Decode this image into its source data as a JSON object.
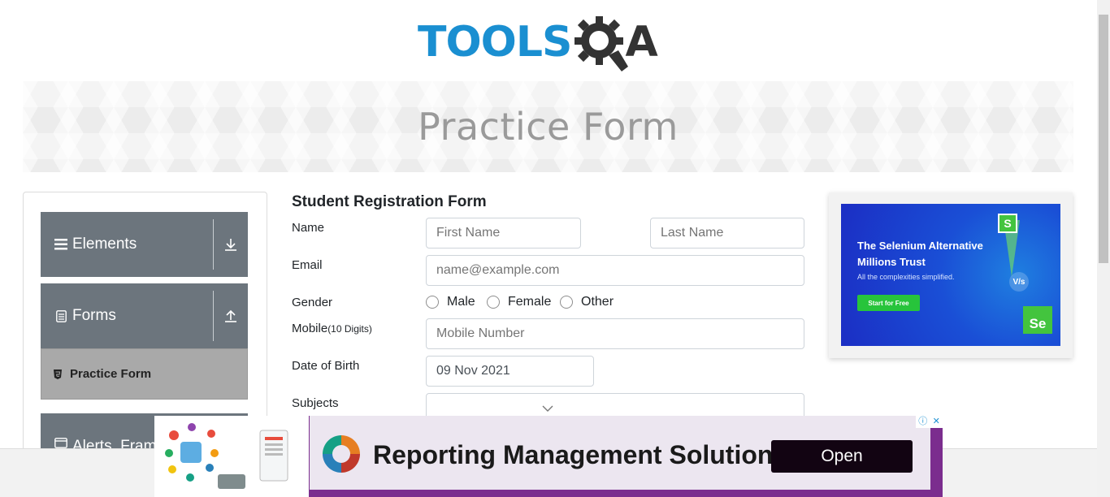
{
  "header": {
    "logo_text": "TOOLS",
    "logo_q": "Q",
    "logo_a": "A",
    "banner_title": "Practice Form"
  },
  "sidebar": {
    "groups": [
      {
        "label": "Elements",
        "icon": "bars-icon",
        "arrow": "download-arrow-icon"
      },
      {
        "label": "Forms",
        "icon": "document-icon",
        "arrow": "upload-arrow-icon"
      },
      {
        "label": "Alerts, Fram",
        "icon": "window-icon"
      }
    ],
    "items": [
      {
        "label": "Practice Form",
        "icon": "html5-shield-icon"
      }
    ]
  },
  "form": {
    "title": "Student Registration Form",
    "name_label": "Name",
    "first_name_placeholder": "First Name",
    "last_name_placeholder": "Last Name",
    "email_label": "Email",
    "email_placeholder": "name@example.com",
    "gender_label": "Gender",
    "gender_options": [
      "Male",
      "Female",
      "Other"
    ],
    "mobile_label": "Mobile",
    "mobile_hint": "(10 Digits)",
    "mobile_placeholder": "Mobile Number",
    "dob_label": "Date of Birth",
    "dob_value": "09 Nov 2021",
    "subjects_label": "Subjects"
  },
  "right_ad": {
    "title_line1": "The Selenium Alternative",
    "title_line2": "Millions Trust",
    "subtitle": "All the complexities simplified.",
    "button": "Start for Free",
    "badge_s": "S",
    "badge_se": "Se",
    "vs": "V/s"
  },
  "bottom_ad": {
    "text": "Reporting Management Solution",
    "button": "Open",
    "info_icon": "ⓘ",
    "close_icon": "✕"
  },
  "colors": {
    "brand_blue": "#1a8fd1",
    "sidebar_gray": "#6c757d",
    "active_item": "#a9a9a9",
    "ad_purple": "#7b2d8e"
  }
}
